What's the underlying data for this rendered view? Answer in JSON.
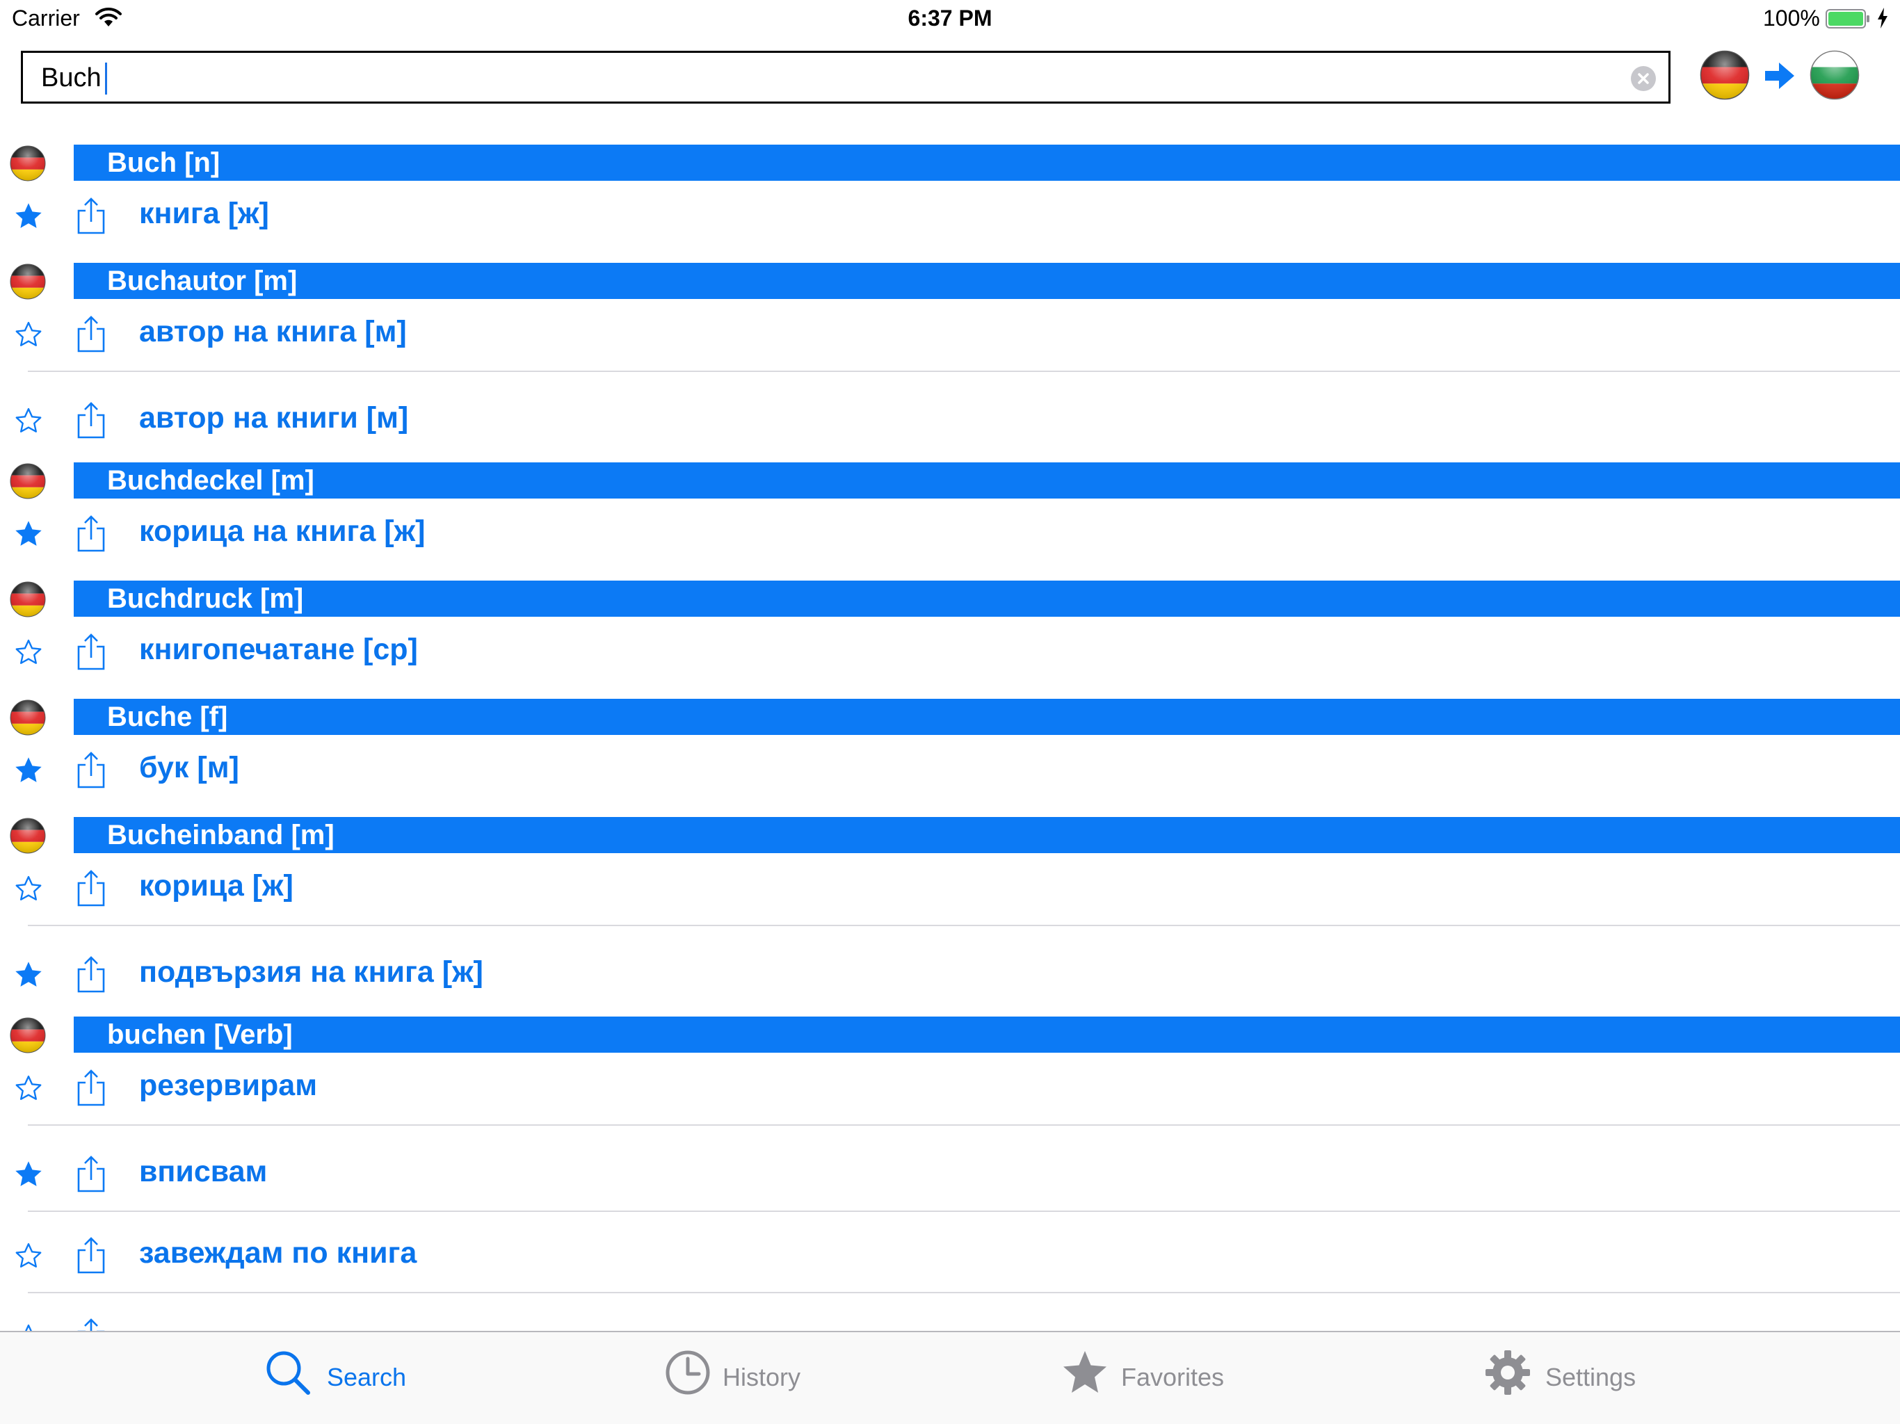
{
  "status_bar": {
    "carrier": "Carrier",
    "time": "6:37 PM",
    "battery_percent": "100%"
  },
  "search": {
    "query": "Buch",
    "placeholder": "",
    "source_language_flag": "germany-flag-icon",
    "target_language_flag": "bulgaria-flag-icon"
  },
  "results": [
    {
      "headword": "Buch [n]",
      "translations": [
        {
          "text": "книга [ж]",
          "favorite": true
        }
      ]
    },
    {
      "headword": "Buchautor [m]",
      "translations": [
        {
          "text": "автор на книга [м]",
          "favorite": false
        },
        {
          "text": "автор на книги [м]",
          "favorite": false
        }
      ]
    },
    {
      "headword": "Buchdeckel [m]",
      "translations": [
        {
          "text": "корица на книга [ж]",
          "favorite": true
        }
      ]
    },
    {
      "headword": "Buchdruck [m]",
      "translations": [
        {
          "text": "книгопечатане [ср]",
          "favorite": false
        }
      ]
    },
    {
      "headword": "Buche [f]",
      "translations": [
        {
          "text": "бук [м]",
          "favorite": true
        }
      ]
    },
    {
      "headword": "Bucheinband [m]",
      "translations": [
        {
          "text": "корица [ж]",
          "favorite": false
        },
        {
          "text": "подвързия на книга [ж]",
          "favorite": true
        }
      ]
    },
    {
      "headword": "buchen [Verb]",
      "translations": [
        {
          "text": "резервирам",
          "favorite": false
        },
        {
          "text": "вписвам",
          "favorite": true
        },
        {
          "text": "завеждам по книга",
          "favorite": false
        },
        {
          "text": "",
          "favorite": false
        }
      ]
    }
  ],
  "tabs": [
    {
      "label": "Search",
      "icon": "search-icon",
      "active": true
    },
    {
      "label": "History",
      "icon": "clock-icon",
      "active": false
    },
    {
      "label": "Favorites",
      "icon": "star-icon",
      "active": false
    },
    {
      "label": "Settings",
      "icon": "gear-icon",
      "active": false
    }
  ],
  "colors": {
    "accent": "#0c7af5",
    "header_text": "#ffffff",
    "inactive": "#8e8e93"
  }
}
